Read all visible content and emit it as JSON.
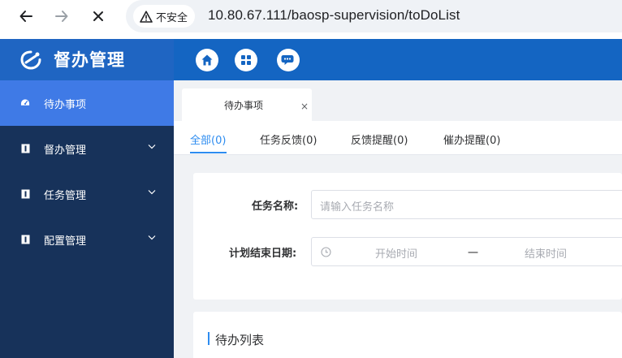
{
  "browser": {
    "security_label": "不安全",
    "url": "10.80.67.111/baosp-supervision/toDoList"
  },
  "app": {
    "title": "督办管理",
    "header_icons": [
      "home-icon",
      "dashboard-icon",
      "message-icon"
    ]
  },
  "sidebar": {
    "items": [
      {
        "label": "待办事项",
        "icon": "dashboard-gauge-icon",
        "active": true
      },
      {
        "label": "督办管理",
        "icon": "menu-block-icon",
        "expandable": true
      },
      {
        "label": "任务管理",
        "icon": "menu-block-icon",
        "expandable": true
      },
      {
        "label": "配置管理",
        "icon": "menu-block-icon",
        "expandable": true
      }
    ]
  },
  "tabs": [
    {
      "label": "待办事项",
      "closable": true
    }
  ],
  "filter_tabs": [
    {
      "label": "全部(0)",
      "active": true
    },
    {
      "label": "任务反馈(0)"
    },
    {
      "label": "反馈提醒(0)"
    },
    {
      "label": "催办提醒(0)"
    }
  ],
  "search_form": {
    "task_name_label": "任务名称:",
    "task_name_placeholder": "请输入任务名称",
    "end_date_label": "计划结束日期:",
    "start_placeholder": "开始时间",
    "range_separator": "一",
    "end_placeholder": "结束时间"
  },
  "list_section": {
    "title": "待办列表"
  },
  "colors": {
    "header_blue": "#1465c2",
    "sidebar_navy": "#17325a",
    "sidebar_active": "#3f7ae6",
    "accent": "#2d8cf0"
  }
}
